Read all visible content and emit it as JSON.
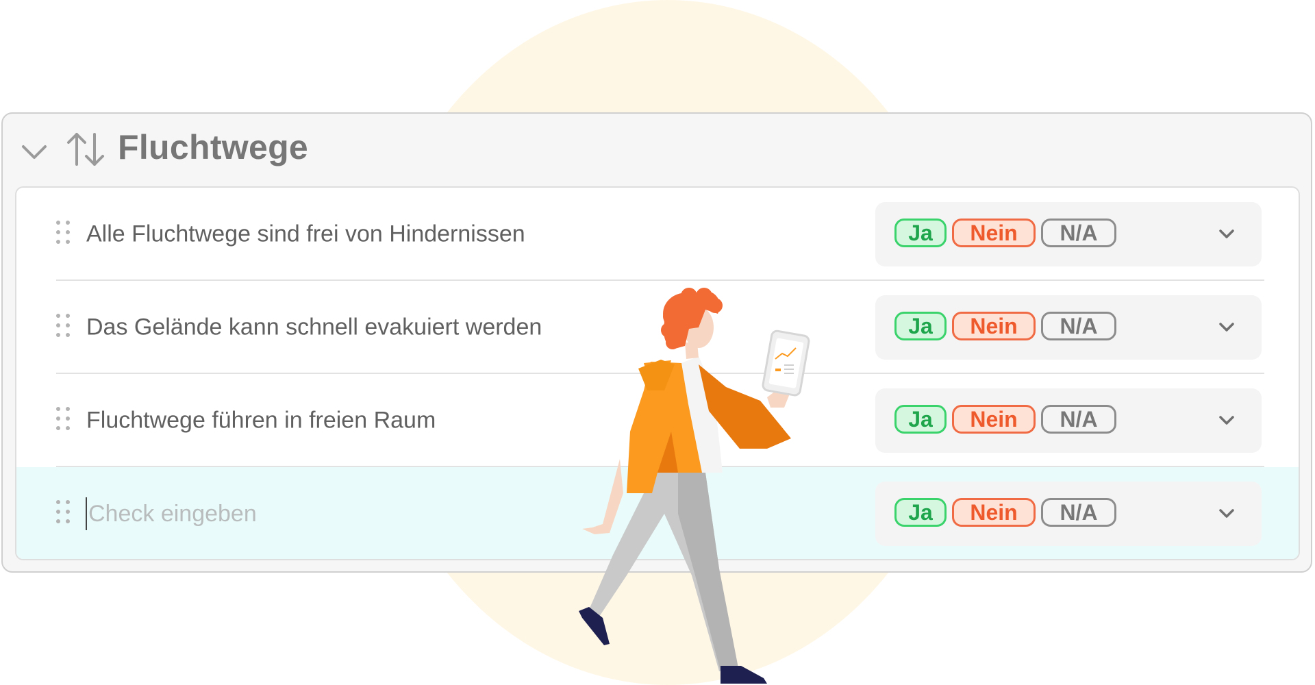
{
  "section": {
    "title": "Fluchtwege",
    "collapse_icon": "chevron-down-icon",
    "sort_icon": "sort-arrows-icon"
  },
  "colors": {
    "yes": "#39d26b",
    "no": "#f06b43",
    "na": "#8c8c8c",
    "active_row": "#e9fcfb",
    "background_circle": "#fff7e6",
    "person_hair": "#f26b35",
    "person_jacket": "#fb9a1f"
  },
  "answers": {
    "yes": "Ja",
    "no": "Nein",
    "na": "N/A"
  },
  "items": [
    {
      "text": "Alle Fluchtwege sind frei von Hindernissen"
    },
    {
      "text": "Das Gelände kann schnell evakuiert werden"
    },
    {
      "text": "Fluchtwege führen in freien Raum"
    }
  ],
  "new_item": {
    "placeholder": "Check eingeben",
    "value": ""
  }
}
